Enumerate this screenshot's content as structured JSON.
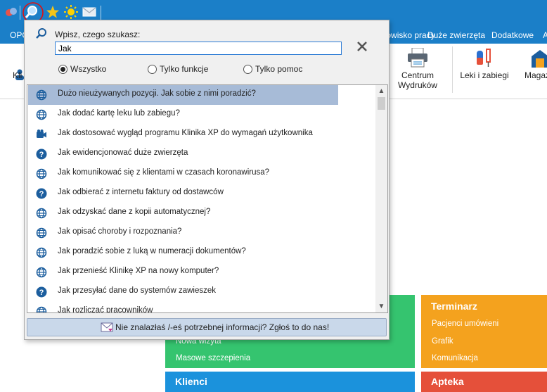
{
  "menubar": {
    "opcje": "OPC",
    "stanowisko": "anowisko pracy",
    "duze": "Duże zwierzęta",
    "dodatkowe": "Dodatkowe",
    "a": "A"
  },
  "ribbon": {
    "kli": "Kli",
    "centrum_line1": "Centrum",
    "centrum_line2": "Wydruków",
    "leki": "Leki i zabiegi",
    "magaz": "Magaz"
  },
  "tiles": {
    "terminarz": {
      "title": "Terminarz",
      "items": [
        "Pacjenci umówieni",
        "Grafik",
        "Komunikacja"
      ]
    },
    "green": {
      "items": [
        "Nowa wizyta",
        "Masowe szczepienia"
      ]
    },
    "klienci": {
      "title": "Klienci"
    },
    "apteka": {
      "title": "Apteka"
    },
    "colors": {
      "green": "#35c46f",
      "orange": "#f4a21e",
      "blue": "#1b92dc",
      "red": "#e5503a"
    }
  },
  "search": {
    "prompt": "Wpisz, czego szukasz:",
    "value": "Jak",
    "filters": {
      "all": "Wszystko",
      "functions": "Tylko funkcje",
      "help": "Tylko pomoc",
      "selected": "all"
    },
    "results": [
      {
        "icon": "globe-icon",
        "text": "Dużo nieużywanych pozycji. Jak sobie z nimi poradzić?",
        "selected": true
      },
      {
        "icon": "globe-icon",
        "text": "Jak dodać kartę leku lub zabiegu?"
      },
      {
        "icon": "video-icon",
        "text": "Jak dostosować wygląd programu Klinika XP do wymagań użytkownika"
      },
      {
        "icon": "help-icon",
        "text": "Jak ewidencjonować duże zwierzęta"
      },
      {
        "icon": "globe-icon",
        "text": "Jak komunikować się z klientami w czasach koronawirusa?"
      },
      {
        "icon": "help-icon",
        "text": "Jak odbierać z internetu faktury od dostawców"
      },
      {
        "icon": "globe-icon",
        "text": "Jak odzyskać dane z kopii automatycznej?"
      },
      {
        "icon": "globe-icon",
        "text": "Jak opisać choroby i rozpoznania?"
      },
      {
        "icon": "globe-icon",
        "text": "Jak poradzić sobie z luką w numeracji dokumentów?"
      },
      {
        "icon": "globe-icon",
        "text": "Jak przenieść Klinikę XP na nowy komputer?"
      },
      {
        "icon": "help-icon",
        "text": "Jak przesyłać dane do systemów zawieszek"
      },
      {
        "icon": "globe-icon",
        "text": "Jak rozliczać pracowników"
      }
    ],
    "feedback": "Nie znalazłaś /-eś potrzebnej informacji? Zgłoś to do nas!"
  }
}
